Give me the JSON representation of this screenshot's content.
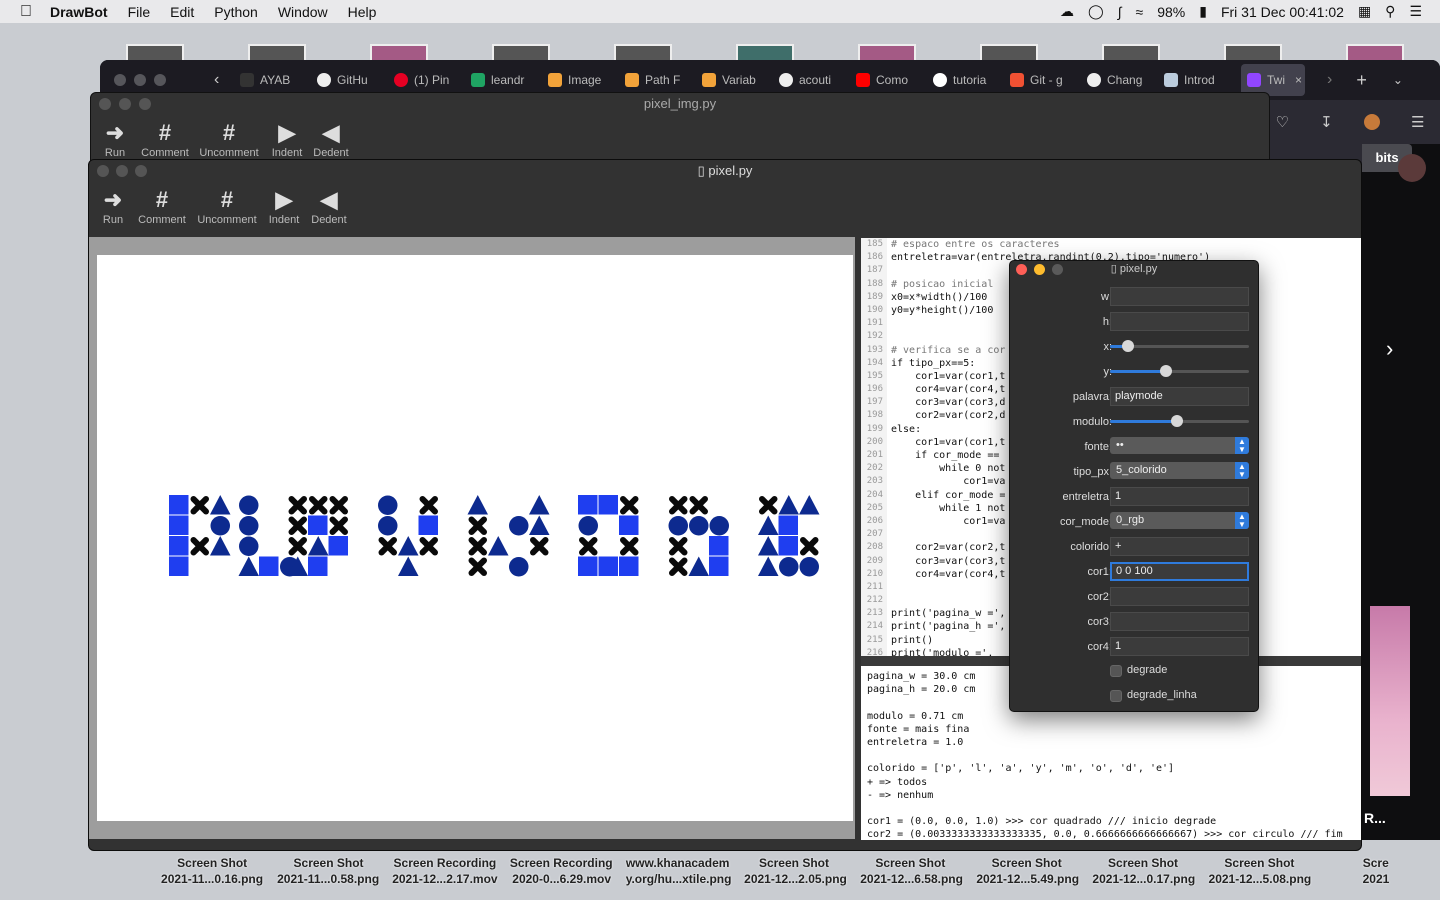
{
  "menubar": {
    "apple": "",
    "app": "DrawBot",
    "items": [
      "File",
      "Edit",
      "Python",
      "Window",
      "Help"
    ],
    "battery": "98%",
    "datetime": "Fri 31 Dec  00:41:02"
  },
  "desktop_files": {
    "row1": [
      "2021-11...0.16.png",
      "2021-11...0.58.png",
      "2021-12...2.17.mov",
      "2020-0...6.29.mov",
      "y.org/hu...xtile.png",
      "2021-12...2.05.png",
      "2021-12...6.58.png",
      "2021-12...5.49.png",
      "2021-12...0.17.png",
      "2021-12...5.08.png",
      "2021"
    ],
    "row2": [
      "Screen Shot",
      "Screen Shot",
      "Screen Recording",
      "Screen Recording",
      "www.khanacadem",
      "Screen Shot",
      "Screen Shot",
      "Screen Shot",
      "Screen Shot",
      "Screen Shot",
      "Scre"
    ]
  },
  "browser": {
    "tabs": [
      "AYAB",
      "GitHu",
      "(1) Pin",
      "leandr",
      "Image",
      "Path F",
      "Variab",
      "acouti",
      "Como",
      "tutoria",
      "Git - g",
      "Chang",
      "Introd",
      "Twi"
    ],
    "right_button": "bits",
    "right_text": "R..."
  },
  "win_back": {
    "title": "pixel_img.py",
    "tools": [
      "Run",
      "Comment",
      "Uncomment",
      "Indent",
      "Dedent"
    ]
  },
  "win_main": {
    "title": "pixel.py",
    "tools": [
      "Run",
      "Comment",
      "Uncomment",
      "Indent",
      "Dedent"
    ],
    "canvas_word": "PLAYMODE",
    "colors": {
      "blue": "#1f3ef0",
      "navy": "#0d2a8f",
      "black": "#0a0a0a"
    }
  },
  "editor": {
    "lines": [
      {
        "n": "185",
        "t": "# espaco entre os caracteres",
        "c": true
      },
      {
        "n": "186",
        "t": "entreletra=var(entreletra,randint(0,2),tipo='numero')",
        "c": false
      },
      {
        "n": "187",
        "t": "",
        "c": false
      },
      {
        "n": "188",
        "t": "# posicao inicial",
        "c": true
      },
      {
        "n": "189",
        "t": "x0=x*width()/100",
        "c": false
      },
      {
        "n": "190",
        "t": "y0=y*height()/100",
        "c": false
      },
      {
        "n": "191",
        "t": "",
        "c": false
      },
      {
        "n": "192",
        "t": "",
        "c": false
      },
      {
        "n": "193",
        "t": "# verifica se a cor",
        "c": true
      },
      {
        "n": "194",
        "t": "if tipo_px==5:",
        "c": false
      },
      {
        "n": "195",
        "t": "    cor1=var(cor1,t",
        "c": false
      },
      {
        "n": "196",
        "t": "    cor4=var(cor4,t",
        "c": false
      },
      {
        "n": "197",
        "t": "    cor3=var(cor3,d",
        "c": false
      },
      {
        "n": "198",
        "t": "    cor2=var(cor2,d",
        "c": false
      },
      {
        "n": "199",
        "t": "else:",
        "c": false
      },
      {
        "n": "200",
        "t": "    cor1=var(cor1,t",
        "c": false
      },
      {
        "n": "201",
        "t": "    if cor_mode ==",
        "c": false
      },
      {
        "n": "202",
        "t": "        while 0 not",
        "c": false
      },
      {
        "n": "203",
        "t": "            cor1=va",
        "c": false
      },
      {
        "n": "204",
        "t": "    elif cor_mode =",
        "c": false
      },
      {
        "n": "205",
        "t": "        while 1 not",
        "c": false
      },
      {
        "n": "206",
        "t": "            cor1=va",
        "c": false
      },
      {
        "n": "207",
        "t": "",
        "c": false
      },
      {
        "n": "208",
        "t": "    cor2=var(cor2,t",
        "c": false
      },
      {
        "n": "209",
        "t": "    cor3=var(cor3,t",
        "c": false
      },
      {
        "n": "210",
        "t": "    cor4=var(cor4,t",
        "c": false
      },
      {
        "n": "211",
        "t": "",
        "c": false
      },
      {
        "n": "212",
        "t": "",
        "c": false
      },
      {
        "n": "213",
        "t": "print('pagina_w =',",
        "c": false
      },
      {
        "n": "214",
        "t": "print('pagina_h =',",
        "c": false
      },
      {
        "n": "215",
        "t": "print()",
        "c": false
      },
      {
        "n": "216",
        "t": "print('modulo =',",
        "c": false
      }
    ]
  },
  "console": {
    "lines": [
      "pagina_w = 30.0 cm",
      "pagina_h = 20.0 cm",
      "",
      "modulo = 0.71 cm",
      "fonte = mais fina",
      "entreletra = 1.0",
      "",
      "colorido = ['p', 'l', 'a', 'y', 'm', 'o', 'd', 'e']",
      "+ => todos",
      "- => nenhum",
      "",
      "cor1 = (0.0, 0.0, 1.0) >>> cor quadrado /// inicio degrade",
      "cor2 = (0.0033333333333333335, 0.0, 0.6666666666666667) >>> cor circulo /// fim"
    ]
  },
  "panel": {
    "title": "pixel.py",
    "w_label": "w:",
    "w_value": "",
    "h_label": "h:",
    "h_value": "",
    "x_label": "x:",
    "x_value": 0.13,
    "y_label": "y:",
    "y_value": 0.4,
    "palavra_label": "palavra:",
    "palavra_value": "playmode",
    "modulo_label": "modulo:",
    "modulo_value": 0.48,
    "fonte_label": "fonte:",
    "fonte_value": "••",
    "tipo_px_label": "tipo_px:",
    "tipo_px_value": "5_colorido",
    "entreletra_label": "entreletra:",
    "entreletra_value": "1",
    "cor_mode_label": "cor_mode:",
    "cor_mode_value": "0_rgb",
    "colorido_label": "colorido:",
    "colorido_value": "+",
    "cor1_label": "cor1:",
    "cor1_value": "0 0 100",
    "cor2_label": "cor2:",
    "cor2_value": "",
    "cor3_label": "cor3:",
    "cor3_value": "",
    "cor4_label": "cor4:",
    "cor4_value": "1",
    "degrade_label": "degrade",
    "degrade_linha_label": "degrade_linha"
  }
}
